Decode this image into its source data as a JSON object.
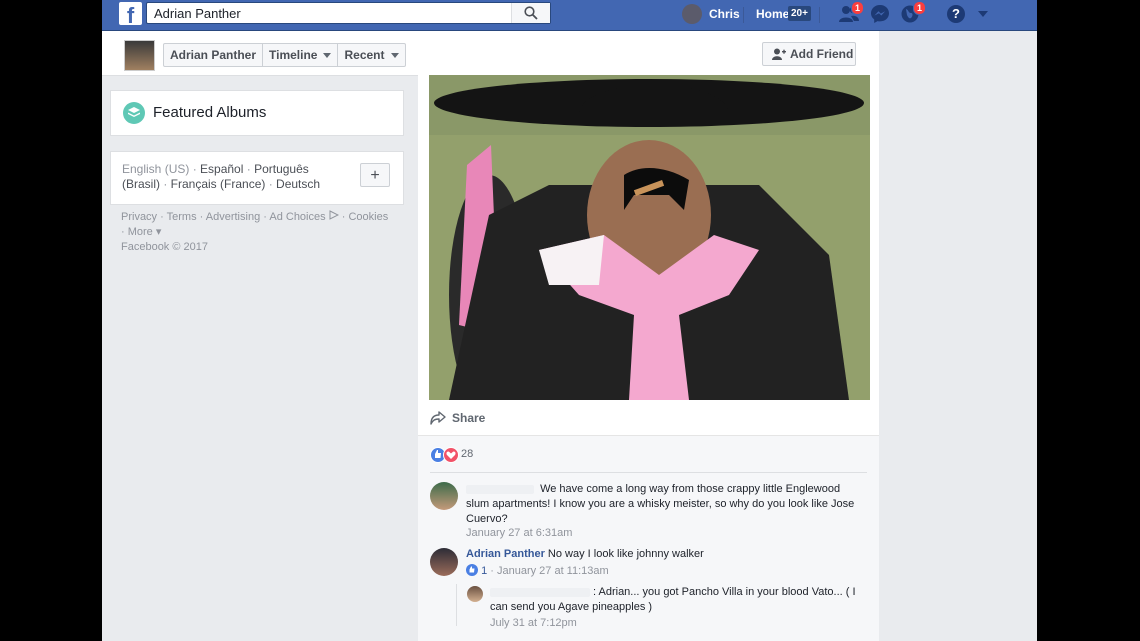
{
  "topbar": {
    "logo": "f",
    "search_value": "Adrian Panther",
    "user_name": "Chris",
    "home_label": "Home",
    "home_count": "20+",
    "friend_requests_badge": "1",
    "notifications_badge": "1",
    "help_label": "?"
  },
  "profile_header": {
    "name": "Adrian Panther",
    "tab_timeline": "Timeline",
    "tab_recent": "Recent",
    "add_friend_label": "Add Friend"
  },
  "left": {
    "featured_albums": "Featured Albums",
    "languages": {
      "current": "English (US)",
      "espanol": "Español",
      "portugues": "Português (Brasil)",
      "francais": "Français (France)",
      "deutsch": "Deutsch",
      "add": "+"
    },
    "footer": {
      "privacy": "Privacy",
      "terms": "Terms",
      "advertising": "Advertising",
      "ad_choices": "Ad Choices",
      "cookies": "Cookies",
      "more": "More",
      "copyright": "Facebook © 2017"
    }
  },
  "post": {
    "share_label": "Share",
    "reaction_count": "28",
    "comments": [
      {
        "text": "We have come a long way from those crappy little Englewood slum apartments! I know you are a whisky meister, so why do you look like Jose Cuervo?",
        "time": "January 27 at 6:31am"
      },
      {
        "author": "Adrian Panther",
        "text": "No way I look like johnny walker",
        "likes": "1",
        "time": "January 27 at 11:13am"
      },
      {
        "text": ": Adrian... you got Pancho Villa in your blood Vato... ( I can send you Agave pineapples )",
        "time": "July 31 at 7:12pm"
      }
    ]
  },
  "colors": {
    "brand_blue": "#4267b2",
    "link_blue": "#365899",
    "page_bg": "#e9ebee"
  }
}
